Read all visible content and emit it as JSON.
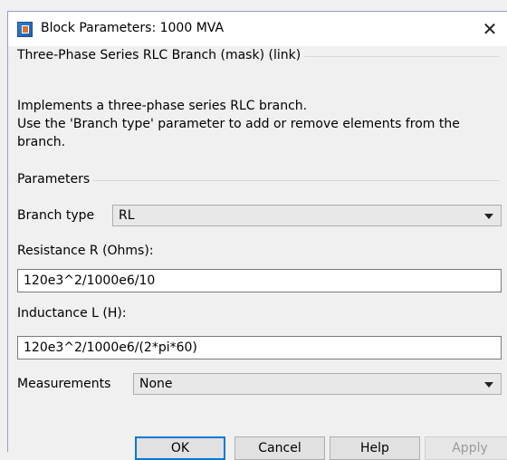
{
  "window": {
    "title": "Block Parameters: 1000 MVA",
    "close_glyph": "✕"
  },
  "mask": {
    "title": "Three-Phase Series RLC Branch (mask) (link)",
    "description": "Implements a three-phase series RLC branch.\nUse the 'Branch type' parameter to add or remove elements from the branch."
  },
  "parameters": {
    "title": "Parameters",
    "branch_type_label": "Branch type",
    "branch_type_value": "RL",
    "resistance_label": "Resistance R (Ohms):",
    "resistance_value": "120e3^2/1000e6/10",
    "inductance_label": "Inductance L (H):",
    "inductance_value": "120e3^2/1000e6/(2*pi*60)",
    "measurements_label": "Measurements",
    "measurements_value": "None"
  },
  "buttons": {
    "ok": "OK",
    "cancel": "Cancel",
    "help": "Help",
    "apply": "Apply"
  }
}
